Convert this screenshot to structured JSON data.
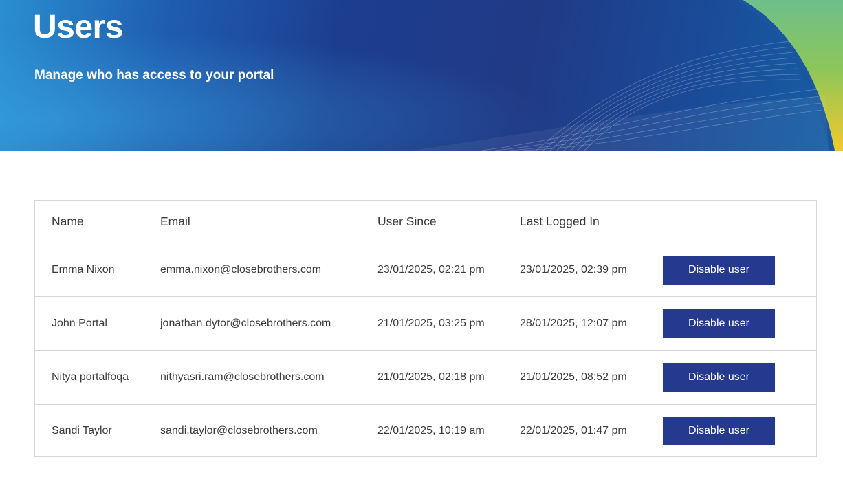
{
  "header": {
    "title": "Users",
    "subtitle": "Manage who has access to your portal"
  },
  "table": {
    "columns": [
      "Name",
      "Email",
      "User Since",
      "Last Logged In"
    ],
    "rows": [
      {
        "name": "Emma Nixon",
        "email": "emma.nixon@closebrothers.com",
        "user_since": "23/01/2025, 02:21 pm",
        "last_logged_in": "23/01/2025, 02:39 pm",
        "action_label": "Disable user"
      },
      {
        "name": "John Portal",
        "email": "jonathan.dytor@closebrothers.com",
        "user_since": "21/01/2025, 03:25 pm",
        "last_logged_in": "28/01/2025, 12:07 pm",
        "action_label": "Disable user"
      },
      {
        "name": "Nitya portalfoqa",
        "email": "nithyasri.ram@closebrothers.com",
        "user_since": "21/01/2025, 02:18 pm",
        "last_logged_in": "21/01/2025, 08:52 pm",
        "action_label": "Disable user"
      },
      {
        "name": "Sandi Taylor",
        "email": "sandi.taylor@closebrothers.com",
        "user_since": "22/01/2025, 10:19 am",
        "last_logged_in": "22/01/2025, 01:47 pm",
        "action_label": "Disable user"
      }
    ]
  },
  "colors": {
    "button_bg": "#253a8e",
    "hero_dark": "#1d3d8f",
    "hero_light": "#2a8fd0",
    "accent_green": "#5fb58a",
    "accent_yellow": "#f0c830"
  }
}
